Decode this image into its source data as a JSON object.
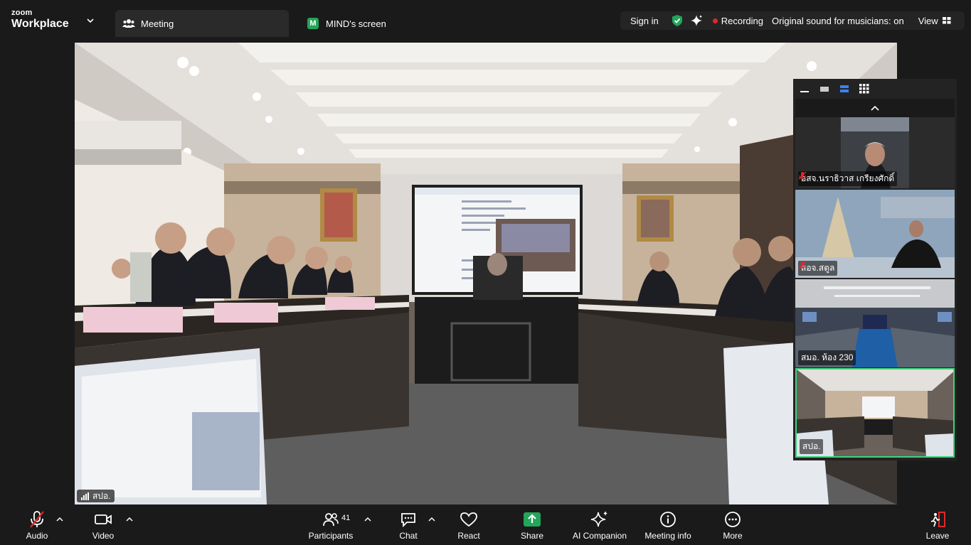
{
  "brand": {
    "top": "zoom",
    "bottom": "Workplace"
  },
  "tabs": {
    "meeting": "Meeting",
    "share_badge": "M",
    "share": "MIND's screen"
  },
  "status": {
    "sign_in": "Sign in",
    "recording": "Recording",
    "original_sound": "Original sound for musicians: on",
    "view": "View"
  },
  "main_video": {
    "label": "สปอ."
  },
  "gallery": {
    "tiles": [
      {
        "label": "อสจ.นราธิวาส เกรียงศักดิ์",
        "muted": true
      },
      {
        "label": "สอจ.สตูล",
        "muted": true
      },
      {
        "label": "สมอ. ห้อง 230",
        "muted": false
      },
      {
        "label": "สปอ.",
        "muted": false
      }
    ]
  },
  "toolbar": {
    "audio": "Audio",
    "video": "Video",
    "participants": "Participants",
    "participants_count": "41",
    "chat": "Chat",
    "react": "React",
    "share": "Share",
    "ai_companion": "AI Companion",
    "meeting_info": "Meeting info",
    "more": "More",
    "leave": "Leave"
  },
  "colors": {
    "share_green": "#23a55a",
    "recording_red": "#e02828",
    "active_tile_border": "#3ed37e",
    "leave_red": "#e02828"
  }
}
